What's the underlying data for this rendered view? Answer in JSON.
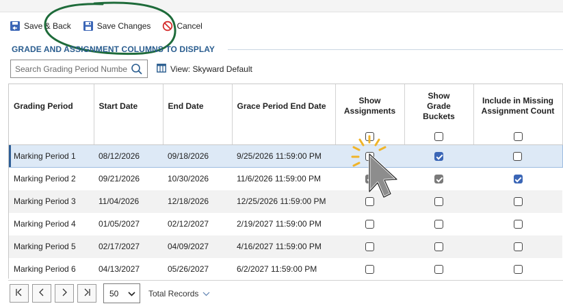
{
  "toolbar": {
    "save_back_label": "Save & Back",
    "save_changes_label": "Save Changes",
    "cancel_label": "Cancel"
  },
  "section": {
    "title": "GRADE AND ASSIGNMENT COLUMNS TO DISPLAY"
  },
  "search": {
    "placeholder": "Search Grading Period Number"
  },
  "view": {
    "label": "View: Skyward Default"
  },
  "grid": {
    "headers": {
      "grading_period": "Grading Period",
      "start_date": "Start Date",
      "end_date": "End Date",
      "grace_end": "Grace Period End Date",
      "show_assignments": "Show Assignments",
      "show_grade_buckets": "Show Grade Buckets",
      "include_missing": "Include in Missing Assignment Count"
    },
    "rows": [
      {
        "period": "Marking Period 1",
        "start": "08/12/2026",
        "end": "09/18/2026",
        "grace": "9/25/2026 11:59:00 PM",
        "show_assignments": false,
        "show_buckets": true,
        "include_missing": false
      },
      {
        "period": "Marking Period 2",
        "start": "09/21/2026",
        "end": "10/30/2026",
        "grace": "11/6/2026 11:59:00 PM",
        "show_assignments": true,
        "show_buckets": true,
        "include_missing": true
      },
      {
        "period": "Marking Period 3",
        "start": "11/04/2026",
        "end": "12/18/2026",
        "grace": "12/25/2026 11:59:00 PM",
        "show_assignments": false,
        "show_buckets": false,
        "include_missing": false
      },
      {
        "period": "Marking Period 4",
        "start": "01/05/2027",
        "end": "02/12/2027",
        "grace": "2/19/2027 11:59:00 PM",
        "show_assignments": false,
        "show_buckets": false,
        "include_missing": false
      },
      {
        "period": "Marking Period 5",
        "start": "02/17/2027",
        "end": "04/09/2027",
        "grace": "4/16/2027 11:59:00 PM",
        "show_assignments": false,
        "show_buckets": false,
        "include_missing": false
      },
      {
        "period": "Marking Period 6",
        "start": "04/13/2027",
        "end": "05/26/2027",
        "grace": "6/2/2027 11:59:00 PM",
        "show_assignments": false,
        "show_buckets": false,
        "include_missing": false
      }
    ]
  },
  "pager": {
    "page_size": "50",
    "total_label": "Total Records"
  },
  "colors": {
    "accent": "#2a5d8f",
    "selected_row": "#dde9f6",
    "checkbox_on": "#3b66b6",
    "annotation_ellipse": "#1e6b3a",
    "cursor_burst": "#f0b429"
  },
  "icons": {
    "save_back": "save-back-icon",
    "save_changes": "floppy-disk-icon",
    "cancel": "cancel-circle-icon",
    "search": "search-icon",
    "view": "columns-view-icon",
    "first_page": "first-page-icon",
    "prev_page": "prev-page-icon",
    "next_page": "next-page-icon",
    "last_page": "last-page-icon",
    "dropdown": "chevron-down-icon",
    "cursor": "mouse-pointer-icon"
  }
}
